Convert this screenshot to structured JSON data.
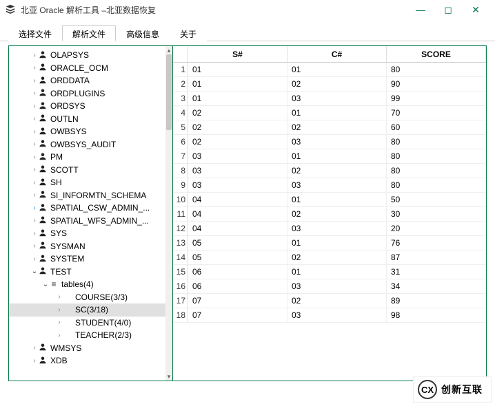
{
  "window": {
    "title": "北亚 Oracle 解析工具  –北亚数据恢复"
  },
  "tabs": {
    "t0": "选择文件",
    "t1": "解析文件",
    "t2": "高级信息",
    "t3": "关于"
  },
  "tree": {
    "n0": "OLAPSYS",
    "n1": "ORACLE_OCM",
    "n2": "ORDDATA",
    "n3": "ORDPLUGINS",
    "n4": "ORDSYS",
    "n5": "OUTLN",
    "n6": "OWBSYS",
    "n7": "OWBSYS_AUDIT",
    "n8": "PM",
    "n9": "SCOTT",
    "n10": "SH",
    "n11": "SI_INFORMTN_SCHEMA",
    "n12": "SPATIAL_CSW_ADMIN_...",
    "n13": "SPATIAL_WFS_ADMIN_...",
    "n14": "SYS",
    "n15": "SYSMAN",
    "n16": "SYSTEM",
    "n17": "TEST",
    "n17a": "tables(4)",
    "n17a0": "COURSE(3/3)",
    "n17a1": "SC(3/18)",
    "n17a2": "STUDENT(4/0)",
    "n17a3": "TEACHER(2/3)",
    "n18": "WMSYS",
    "n19": "XDB"
  },
  "grid": {
    "cols": {
      "c0": "S#",
      "c1": "C#",
      "c2": "SCORE"
    },
    "rows": [
      {
        "i": "1",
        "s": "01",
        "c": "01",
        "v": "80"
      },
      {
        "i": "2",
        "s": "01",
        "c": "02",
        "v": "90"
      },
      {
        "i": "3",
        "s": "01",
        "c": "03",
        "v": "99"
      },
      {
        "i": "4",
        "s": "02",
        "c": "01",
        "v": "70"
      },
      {
        "i": "5",
        "s": "02",
        "c": "02",
        "v": "60"
      },
      {
        "i": "6",
        "s": "02",
        "c": "03",
        "v": "80"
      },
      {
        "i": "7",
        "s": "03",
        "c": "01",
        "v": "80"
      },
      {
        "i": "8",
        "s": "03",
        "c": "02",
        "v": "80"
      },
      {
        "i": "9",
        "s": "03",
        "c": "03",
        "v": "80"
      },
      {
        "i": "10",
        "s": "04",
        "c": "01",
        "v": "50"
      },
      {
        "i": "11",
        "s": "04",
        "c": "02",
        "v": "30"
      },
      {
        "i": "12",
        "s": "04",
        "c": "03",
        "v": "20"
      },
      {
        "i": "13",
        "s": "05",
        "c": "01",
        "v": "76"
      },
      {
        "i": "14",
        "s": "05",
        "c": "02",
        "v": "87"
      },
      {
        "i": "15",
        "s": "06",
        "c": "01",
        "v": "31"
      },
      {
        "i": "16",
        "s": "06",
        "c": "03",
        "v": "34"
      },
      {
        "i": "17",
        "s": "07",
        "c": "02",
        "v": "89"
      },
      {
        "i": "18",
        "s": "07",
        "c": "03",
        "v": "98"
      }
    ]
  },
  "brand": {
    "mark": "CX",
    "text": "创新互联"
  }
}
